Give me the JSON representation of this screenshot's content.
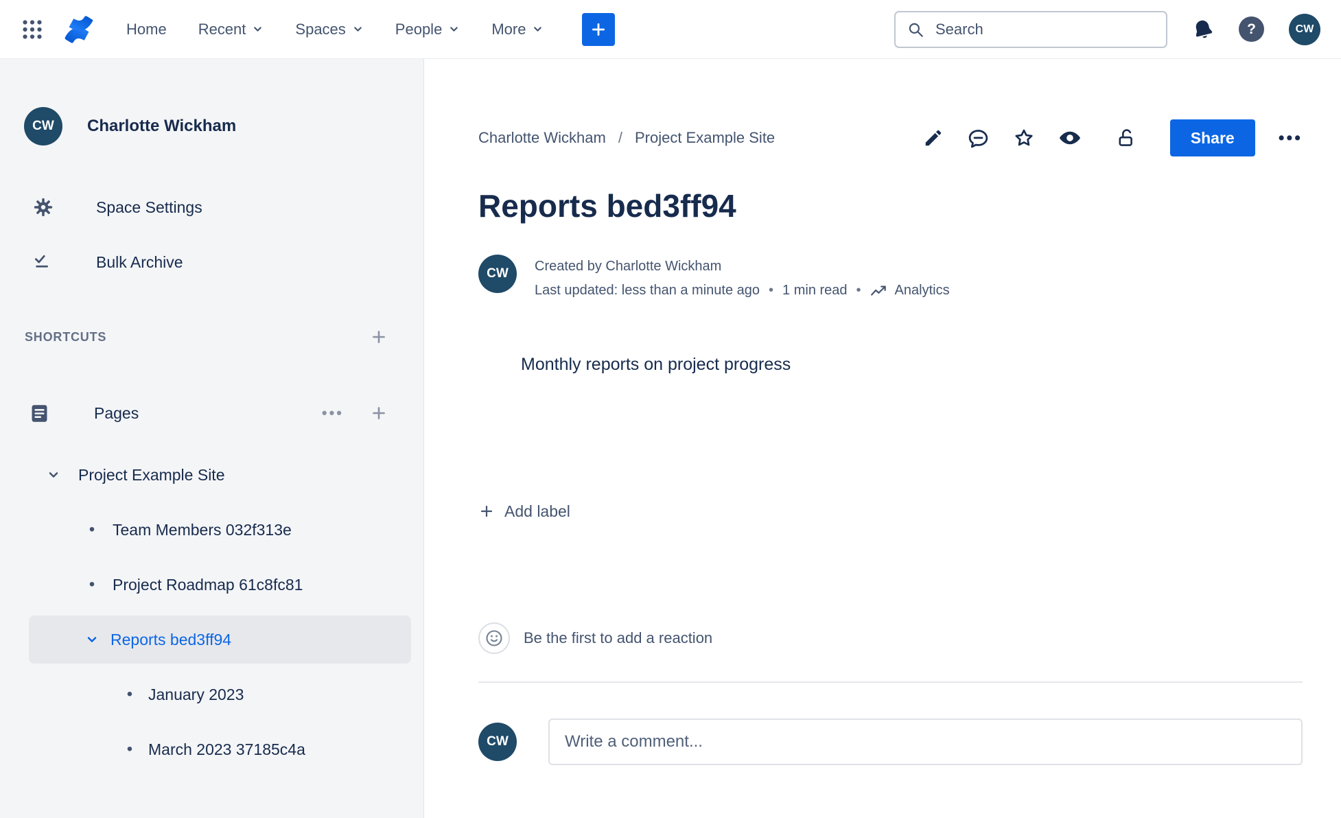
{
  "colors": {
    "accent": "#0C66E4",
    "avatar_bg": "#1F4A68",
    "icon": "#44546F",
    "text": "#172B4D",
    "text_subtle": "#44546F"
  },
  "icons": {
    "more_horizontal": "•••",
    "bullet": "•",
    "dot_separator": "•",
    "help_glyph": "?"
  },
  "topnav": {
    "menu": [
      {
        "label": "Home"
      },
      {
        "label": "Recent"
      },
      {
        "label": "Spaces"
      },
      {
        "label": "People"
      },
      {
        "label": "More"
      }
    ],
    "search_placeholder": "Search",
    "user_initials": "CW"
  },
  "sidebar": {
    "space_name": "Charlotte Wickham",
    "space_initials": "CW",
    "nav": [
      {
        "label": "Space Settings"
      },
      {
        "label": "Bulk Archive"
      }
    ],
    "shortcuts_heading": "SHORTCUTS",
    "pages_heading": "Pages",
    "tree": [
      {
        "label": "Project Example Site"
      },
      {
        "label": "Team Members 032f313e"
      },
      {
        "label": "Project Roadmap 61c8fc81"
      },
      {
        "label": "Reports bed3ff94",
        "selected": true
      },
      {
        "label": "January 2023"
      },
      {
        "label": "March 2023 37185c4a"
      }
    ]
  },
  "content": {
    "breadcrumbs": [
      {
        "label": "Charlotte Wickham"
      },
      {
        "label": "Project Example Site"
      }
    ],
    "breadcrumb_separator": "/",
    "share_button": "Share",
    "title": "Reports bed3ff94",
    "byline": {
      "initials": "CW",
      "created_by": "Created by Charlotte Wickham",
      "last_updated": "Last updated: less than a minute ago",
      "read_time": "1 min read",
      "analytics_label": "Analytics"
    },
    "body_text": "Monthly reports on project progress",
    "add_label_button": "Add label",
    "reaction_prompt": "Be the first to add a reaction",
    "comment_placeholder": "Write a comment..."
  }
}
